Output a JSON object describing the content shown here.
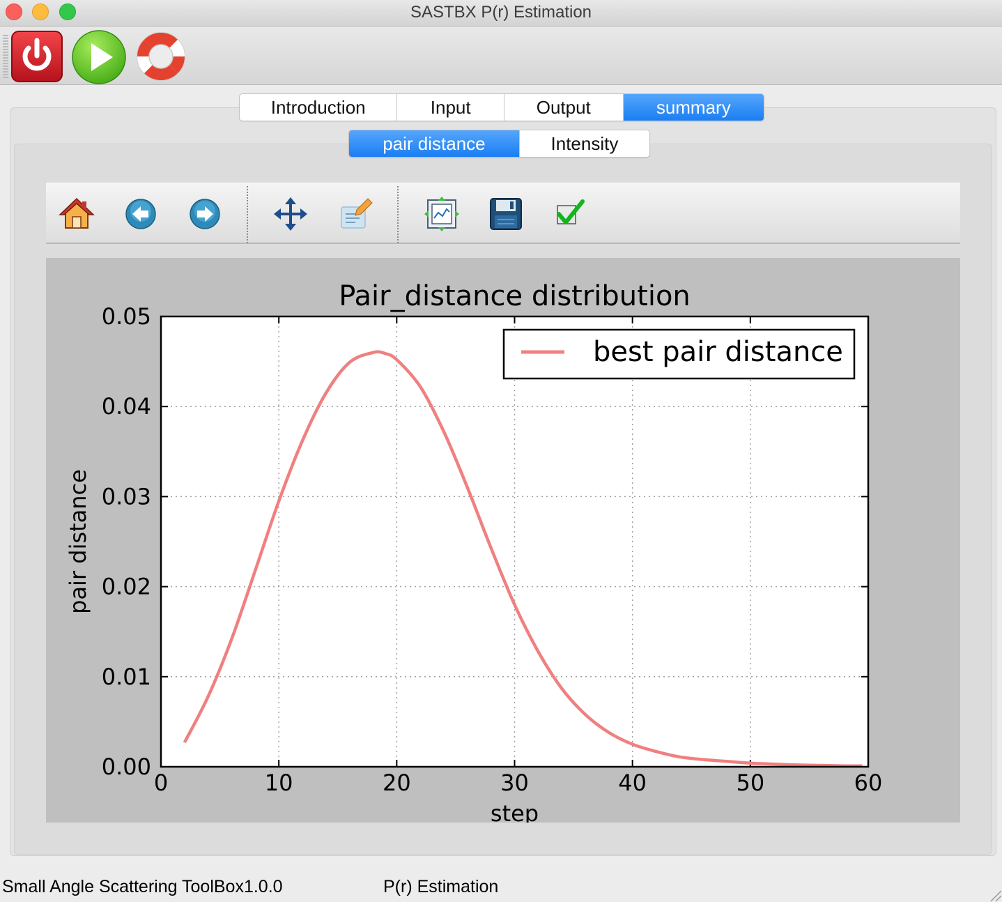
{
  "window": {
    "title": "SASTBX P(r) Estimation"
  },
  "app_toolbar": {
    "buttons": [
      {
        "name": "quit",
        "icon": "power-icon",
        "color": "#d9232a"
      },
      {
        "name": "run",
        "icon": "play-icon",
        "color": "#5cc21f"
      },
      {
        "name": "help",
        "icon": "lifebuoy-icon",
        "color": "#e5412f"
      }
    ]
  },
  "main_tabs": [
    {
      "label": "Introduction",
      "active": false
    },
    {
      "label": "Input",
      "active": false
    },
    {
      "label": "Output",
      "active": false
    },
    {
      "label": "summary",
      "active": true
    }
  ],
  "sub_tabs": [
    {
      "label": "pair distance",
      "active": true
    },
    {
      "label": "Intensity",
      "active": false
    }
  ],
  "plot_toolbar": {
    "buttons": [
      {
        "icon": "home-icon"
      },
      {
        "icon": "back-arrow-icon"
      },
      {
        "icon": "forward-arrow-icon"
      },
      {
        "icon": "pan-icon"
      },
      {
        "icon": "zoom-rect-icon"
      },
      {
        "icon": "subplots-config-icon"
      },
      {
        "icon": "save-disk-icon"
      },
      {
        "icon": "checkmark-icon"
      }
    ]
  },
  "chart_data": {
    "type": "line",
    "title": "Pair_distance distribution",
    "xlabel": "step",
    "ylabel": "pair distance",
    "xlim": [
      0,
      60
    ],
    "ylim": [
      0,
      0.05
    ],
    "xticks": [
      "0",
      "10",
      "20",
      "30",
      "40",
      "50",
      "60"
    ],
    "yticks": [
      "0.00",
      "0.01",
      "0.02",
      "0.03",
      "0.04",
      "0.05"
    ],
    "grid": true,
    "legend_position": "top-right",
    "series": [
      {
        "name": "best pair distance",
        "color": "#f08080",
        "x": [
          2,
          4,
          6,
          8,
          10,
          12,
          14,
          16,
          18,
          19,
          20,
          22,
          24,
          26,
          28,
          30,
          32,
          34,
          36,
          38,
          40,
          42,
          44,
          46,
          48,
          50,
          52,
          54,
          56,
          58,
          59.5
        ],
        "y": [
          0.0027,
          0.0078,
          0.0142,
          0.0218,
          0.0295,
          0.0362,
          0.0415,
          0.0449,
          0.046,
          0.0459,
          0.0452,
          0.0422,
          0.0372,
          0.031,
          0.0243,
          0.018,
          0.0128,
          0.0087,
          0.0058,
          0.0038,
          0.0025,
          0.0017,
          0.0011,
          0.0008,
          0.0006,
          0.0004,
          0.0003,
          0.0002,
          0.00015,
          0.0001,
          0.0001
        ]
      }
    ]
  },
  "status_bar": {
    "left": "Small Angle Scattering ToolBox1.0.0",
    "center": "P(r) Estimation"
  }
}
